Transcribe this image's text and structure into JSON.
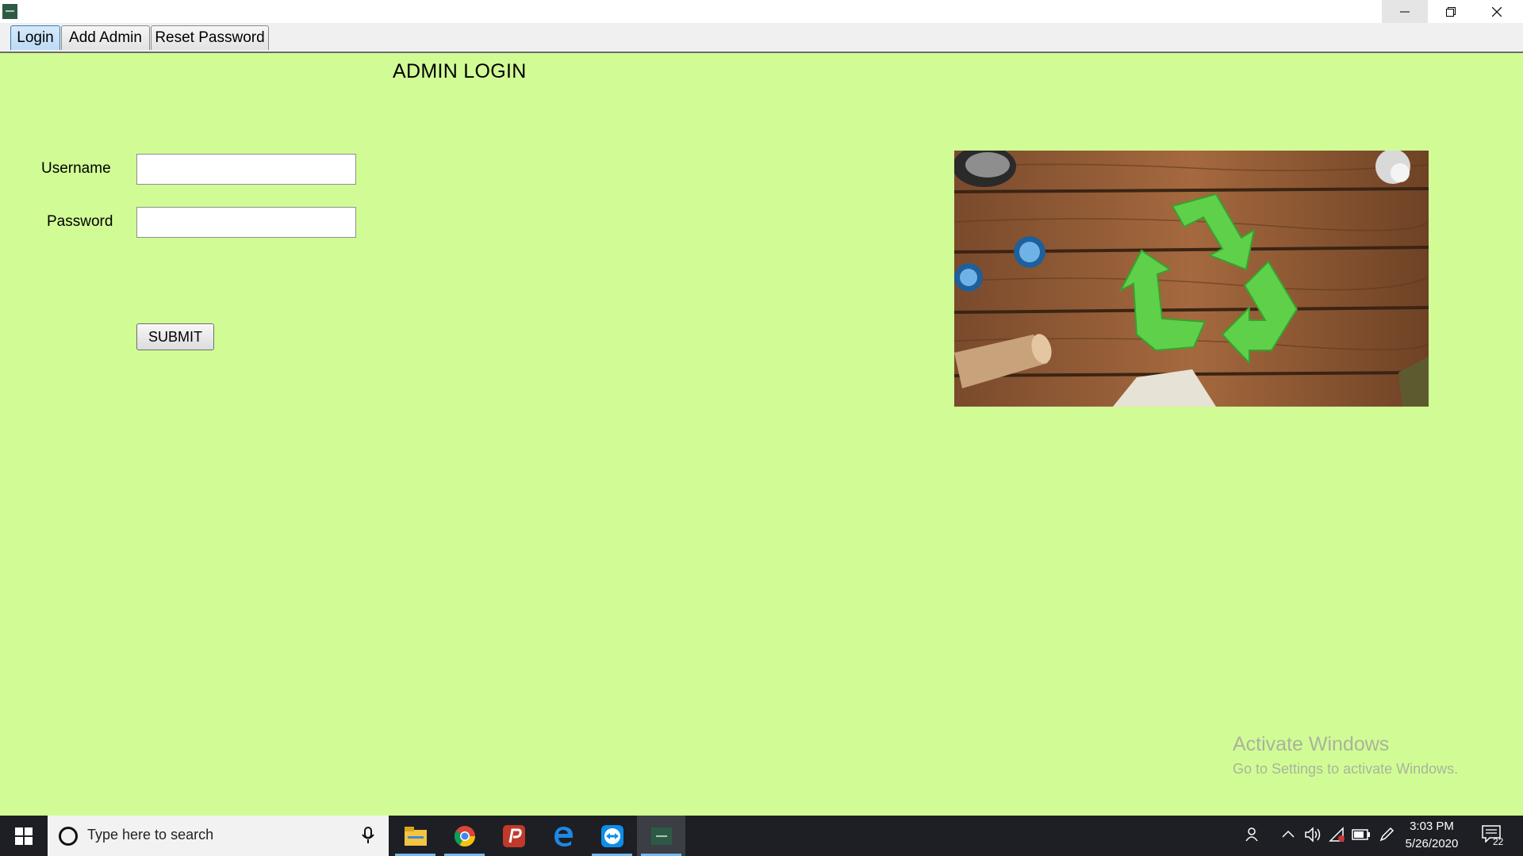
{
  "window": {
    "app_icon": "app-logo-icon",
    "controls": [
      "minimize-icon",
      "restore-icon",
      "close-icon"
    ]
  },
  "tabs": [
    {
      "label": "Login",
      "active": true
    },
    {
      "label": "Add Admin",
      "active": false
    },
    {
      "label": "Reset Password",
      "active": false
    }
  ],
  "form": {
    "title": "ADMIN LOGIN",
    "username_label": "Username",
    "username_value": "",
    "password_label": "Password",
    "password_value": "",
    "submit_label": "SUBMIT"
  },
  "hero_image": "recycling-symbol-on-wood-image",
  "watermark": {
    "title": "Activate Windows",
    "subtitle": "Go to Settings to activate Windows."
  },
  "taskbar": {
    "search_placeholder": "Type here to search",
    "apps": [
      "file-explorer-icon",
      "chrome-icon",
      "app-p-icon",
      "edge-icon",
      "teamviewer-icon",
      "swcs-app-icon"
    ],
    "tray": [
      "people-icon",
      "chevron-up-icon",
      "volume-icon",
      "network-icon",
      "battery-icon",
      "pen-icon"
    ],
    "time": "3:03 PM",
    "date": "5/26/2020",
    "notification_count": "22"
  },
  "colors": {
    "background": "#d1fc95",
    "taskbar": "#1d1f24",
    "recycle_green": "#5fd04a"
  }
}
